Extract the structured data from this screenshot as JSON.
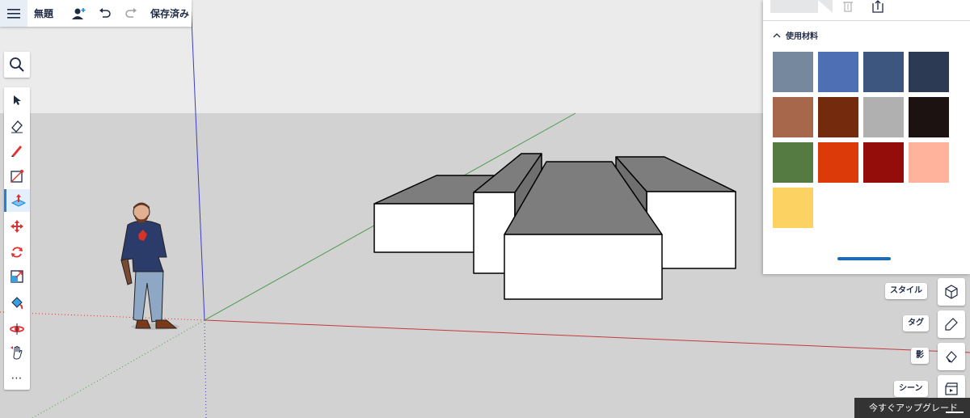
{
  "toolbar": {
    "title": "無題",
    "save_status": "保存済み"
  },
  "tools": [
    {
      "name": "select-tool-icon"
    },
    {
      "name": "eraser-tool-icon"
    },
    {
      "name": "pencil-tool-icon"
    },
    {
      "name": "shape-tool-icon"
    },
    {
      "name": "push-pull-tool-icon",
      "active": true
    },
    {
      "name": "move-tool-icon"
    },
    {
      "name": "rotate-tool-icon"
    },
    {
      "name": "scale-tool-icon"
    },
    {
      "name": "paint-bucket-tool-icon"
    },
    {
      "name": "orbit-tool-icon"
    },
    {
      "name": "pan-tool-icon"
    }
  ],
  "more_tools": "⋯",
  "materials": {
    "section_title": "使用材料",
    "swatches": [
      "#76889d",
      "#4f6fb5",
      "#3d5680",
      "#2d3a53",
      "#a7674a",
      "#732a0d",
      "#b0b0b0",
      "#1d1212",
      "#567b42",
      "#dd3a0a",
      "#950d0a",
      "#ffb39c",
      "#fcd363"
    ]
  },
  "dock": {
    "styles_label": "スタイル",
    "tags_label": "タグ",
    "shadows_label": "影",
    "scenes_label": "シーン"
  },
  "upgrade": {
    "label": "今すぐアップグレード"
  },
  "colors": {
    "sky": "#ebebeb",
    "ground": "#d2d2d2",
    "axis_red": "#c43a3a",
    "axis_green": "#4c9a4c",
    "axis_blue": "#3d3dc0",
    "box_top": "#7d7d7d",
    "box_front": "#ffffff",
    "accent": "#1b84d6"
  }
}
